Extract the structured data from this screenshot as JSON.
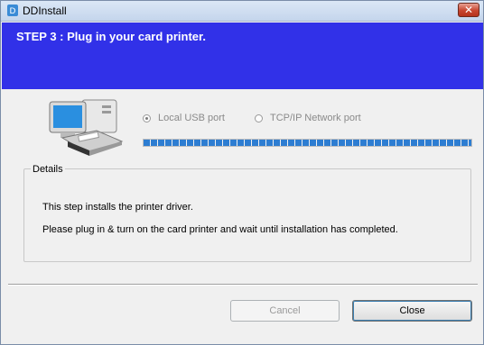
{
  "window": {
    "title": "DDInstall"
  },
  "banner": {
    "step_title": "STEP 3 :  Plug in your card printer."
  },
  "connection": {
    "options": [
      {
        "label": "Local USB port",
        "selected": true
      },
      {
        "label": "TCP/IP Network port",
        "selected": false
      }
    ],
    "progress_fraction": 1.0
  },
  "details": {
    "legend": "Details",
    "line1": "This step installs the printer driver.",
    "line2": "Please plug in & turn on the card printer and wait until installation has completed."
  },
  "buttons": {
    "cancel": "Cancel",
    "close": "Close"
  },
  "colors": {
    "banner": "#3131e8",
    "progress": "#2d7dd2"
  },
  "icons": {
    "app": "ddinstall-app-icon",
    "close": "close-icon",
    "illustration": "computer-card-printer-illustration"
  }
}
